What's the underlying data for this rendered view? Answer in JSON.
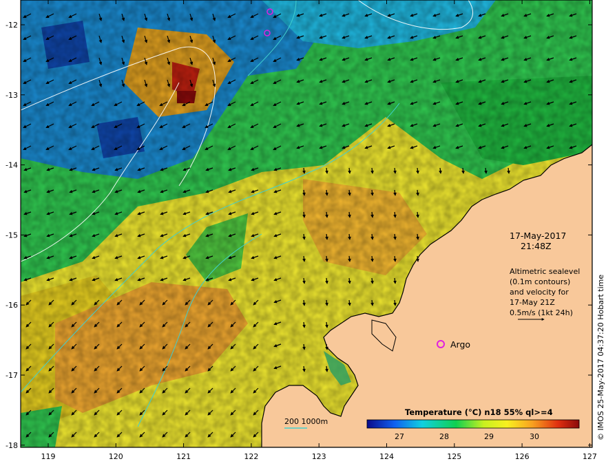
{
  "map": {
    "lon_ticks": [
      "119",
      "120",
      "121",
      "122",
      "123",
      "124",
      "125",
      "126",
      "127"
    ],
    "lat_ticks": [
      "-12",
      "-13",
      "-14",
      "-15",
      "-16",
      "-17",
      "-18"
    ]
  },
  "annotation": {
    "date": "17-May-2017",
    "time": "21:48Z",
    "legend_lines": [
      "Altimetric sealevel",
      "(0.1m contours)",
      "and velocity for",
      "17-May 21Z",
      "0.5m/s (1kt 24h)"
    ]
  },
  "argo": {
    "label": "Argo",
    "marker_color": "#e020e0"
  },
  "bathymetry": {
    "label": "200  1000m",
    "line_color": "#40d0d0"
  },
  "colorbar": {
    "title": "Temperature (°C) n18 55% ql>=4",
    "ticks": [
      "27",
      "28",
      "29",
      "30"
    ],
    "stops": [
      "#0a0a8a",
      "#1060f0",
      "#10d0e0",
      "#10d050",
      "#c8f020",
      "#f8f020",
      "#f8a020",
      "#e03010",
      "#8a0a0a"
    ]
  },
  "credit": "© IMOS 25-May-2017 04:37:20 Hobart time",
  "colors": {
    "land": "#f8c89a",
    "frame": "#000000",
    "contour": "#ffffff"
  }
}
